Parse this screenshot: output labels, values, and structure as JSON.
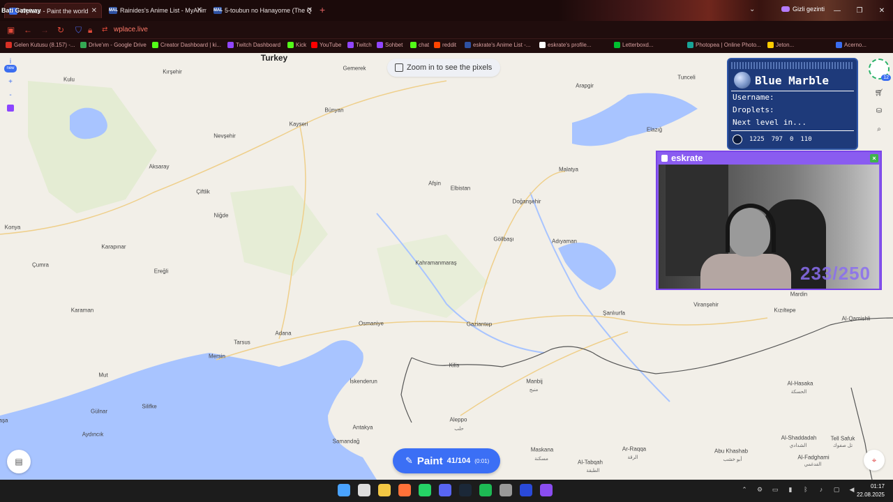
{
  "browser": {
    "overlay_text": "Bati Gateway",
    "tabs": [
      {
        "title": "Wplace - Paint the world",
        "icon": "wplace-icon",
        "active": true
      },
      {
        "title": "Rainides's Anime List - MyAnim",
        "icon": "mal-icon",
        "active": false
      },
      {
        "title": "5-toubun no Hanayome (The Q",
        "icon": "mal-icon",
        "active": false
      }
    ],
    "tab_icon_text": "MAL",
    "private_label": "Gizli gezinti",
    "url": "wplace.live",
    "bookmarks": [
      {
        "label": "Gelen Kutusu (8.157) -...",
        "color": "#d93025"
      },
      {
        "label": "Drive'ım - Google Drive",
        "color": "#34a853"
      },
      {
        "label": "Creator Dashboard | ki...",
        "color": "#53fc18"
      },
      {
        "label": "Twitch Dashboard",
        "color": "#9146ff"
      },
      {
        "label": "Kick",
        "color": "#53fc18"
      },
      {
        "label": "YouTube",
        "color": "#ff0000"
      },
      {
        "label": "Twitch",
        "color": "#9146ff"
      },
      {
        "label": "Sohbet",
        "color": "#9146ff"
      },
      {
        "label": "chat",
        "color": "#53fc18"
      },
      {
        "label": "reddit",
        "color": "#ff4500"
      },
      {
        "label": "eskrate's Anime List -...",
        "color": "#2e51a2"
      },
      {
        "label": "eskrate's profile...",
        "color": "#ffffff"
      },
      {
        "label": "Letterboxd...",
        "color": "#00c030"
      },
      {
        "label": "Photopea | Online Photo...",
        "color": "#18a497"
      },
      {
        "label": "Jeton...",
        "color": "#ffcc00"
      },
      {
        "label": "Acerno...",
        "color": "#3a6df0"
      }
    ]
  },
  "map": {
    "zoom_hint": "Zoom in to see the pixels",
    "country_label": "Turkey",
    "cities": [
      {
        "name": "Kırşehir"
      },
      {
        "name": "Kulu"
      },
      {
        "name": "Gemerek"
      },
      {
        "name": "Bünyan"
      },
      {
        "name": "Kayseri"
      },
      {
        "name": "Nevşehir"
      },
      {
        "name": "Aksaray"
      },
      {
        "name": "Çiftlik"
      },
      {
        "name": "Niğde"
      },
      {
        "name": "Konya"
      },
      {
        "name": "Karapınar"
      },
      {
        "name": "Çumra"
      },
      {
        "name": "Ereğli"
      },
      {
        "name": "Karaman"
      },
      {
        "name": "Tarsus"
      },
      {
        "name": "Adana"
      },
      {
        "name": "Mersin"
      },
      {
        "name": "Mut"
      },
      {
        "name": "Silifke"
      },
      {
        "name": "Gülnar"
      },
      {
        "name": "Aydıncık"
      },
      {
        "name": "Osmaniye"
      },
      {
        "name": "İskenderun"
      },
      {
        "name": "Antakya"
      },
      {
        "name": "Samandağ"
      },
      {
        "name": "Afşin"
      },
      {
        "name": "Elbistan"
      },
      {
        "name": "Kahramanmaraş"
      },
      {
        "name": "Gaziantep"
      },
      {
        "name": "Kilis"
      },
      {
        "name": "Manbij"
      },
      {
        "name": "Aleppo"
      },
      {
        "name": "Maskana"
      },
      {
        "name": "Al-Tabqah"
      },
      {
        "name": "Ar-Raqqa"
      },
      {
        "name": "Göllbaşı"
      },
      {
        "name": "Doğanşehir"
      },
      {
        "name": "Malatya"
      },
      {
        "name": "Adıyaman"
      },
      {
        "name": "Şanlıurfa"
      },
      {
        "name": "Viranşehir"
      },
      {
        "name": "Kızıltepe"
      },
      {
        "name": "Mardin"
      },
      {
        "name": "Al-Qamishli"
      },
      {
        "name": "Al-Hasaka"
      },
      {
        "name": "Al-Shaddadah"
      },
      {
        "name": "Tell Safuk"
      },
      {
        "name": "Abu Khashab"
      },
      {
        "name": "Al-Fadghami"
      },
      {
        "name": "Elazığ"
      },
      {
        "name": "Arapgir"
      },
      {
        "name": "Tunceli"
      },
      {
        "name": "aşa"
      }
    ],
    "arabic_labels": [
      {
        "text": "منبج"
      },
      {
        "text": "حلب"
      },
      {
        "text": "مسكنة"
      },
      {
        "text": "الطبقة"
      },
      {
        "text": "الرقة"
      },
      {
        "text": "أبو خشب"
      },
      {
        "text": "الشدادي"
      },
      {
        "text": "الحسكة"
      },
      {
        "text": "تل صفوك"
      },
      {
        "text": "الفدغمي"
      }
    ]
  },
  "left_tools": {
    "info_label": "i",
    "new_badge": "new",
    "zoom_in": "+",
    "zoom_out": "-"
  },
  "right_tools": {
    "level": "12"
  },
  "blue_marble": {
    "title": "Blue Marble",
    "username_label": "Username:",
    "droplets_label": "Droplets:",
    "next_level_label": "Next level in...",
    "coords": [
      "1225",
      "797",
      "0",
      "110"
    ]
  },
  "webcam": {
    "channel": "eskrate",
    "close": "×",
    "overlay_count": "233/250"
  },
  "paint_button": {
    "label": "Paint",
    "count": "41/104",
    "timer": "(0:01)"
  },
  "taskbar": {
    "time": "01:17",
    "date": "22.08.2025",
    "apps": [
      {
        "name": "start",
        "color": "#4aa3ff"
      },
      {
        "name": "search",
        "color": "#dddddd"
      },
      {
        "name": "file-explorer",
        "color": "#f2c744"
      },
      {
        "name": "firefox",
        "color": "#ff7139"
      },
      {
        "name": "whatsapp",
        "color": "#25d366"
      },
      {
        "name": "discord",
        "color": "#5865f2"
      },
      {
        "name": "steam",
        "color": "#1b2838"
      },
      {
        "name": "spotify",
        "color": "#1db954"
      },
      {
        "name": "chatgpt",
        "color": "#999999"
      },
      {
        "name": "app-9",
        "color": "#2a4ad9"
      },
      {
        "name": "obs",
        "color": "#8a4df0"
      }
    ]
  },
  "colors": {
    "accent": "#3b6ff5",
    "land": "#f2efe8",
    "water": "#a8c4ff",
    "border": "#555555",
    "panel": "#1e3a7a",
    "cam_border": "#7a44e8"
  }
}
